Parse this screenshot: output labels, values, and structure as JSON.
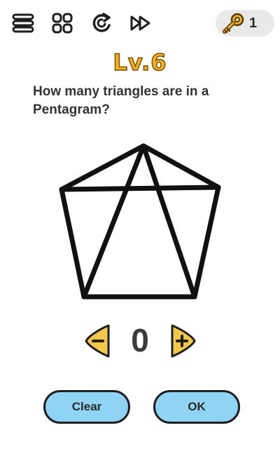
{
  "topbar": {
    "icons": [
      "menu-icon",
      "levels-grid-icon",
      "restart-icon",
      "skip-icon"
    ],
    "key_icon": "key-icon",
    "key_count": "1"
  },
  "level": {
    "title": "Lv.6"
  },
  "question": {
    "text": "How many triangles are in a Pentagram?"
  },
  "stepper": {
    "value": "0",
    "minus_icon": "minus-icon",
    "plus_icon": "plus-icon"
  },
  "actions": {
    "clear_label": "Clear",
    "ok_label": "OK"
  },
  "colors": {
    "level_title": "#f5b21b",
    "button_fill": "#8fd3f5",
    "stepper_fill": "#f5c84a",
    "key_fill": "#f0b323",
    "key_pill": "#e9e9e9"
  }
}
